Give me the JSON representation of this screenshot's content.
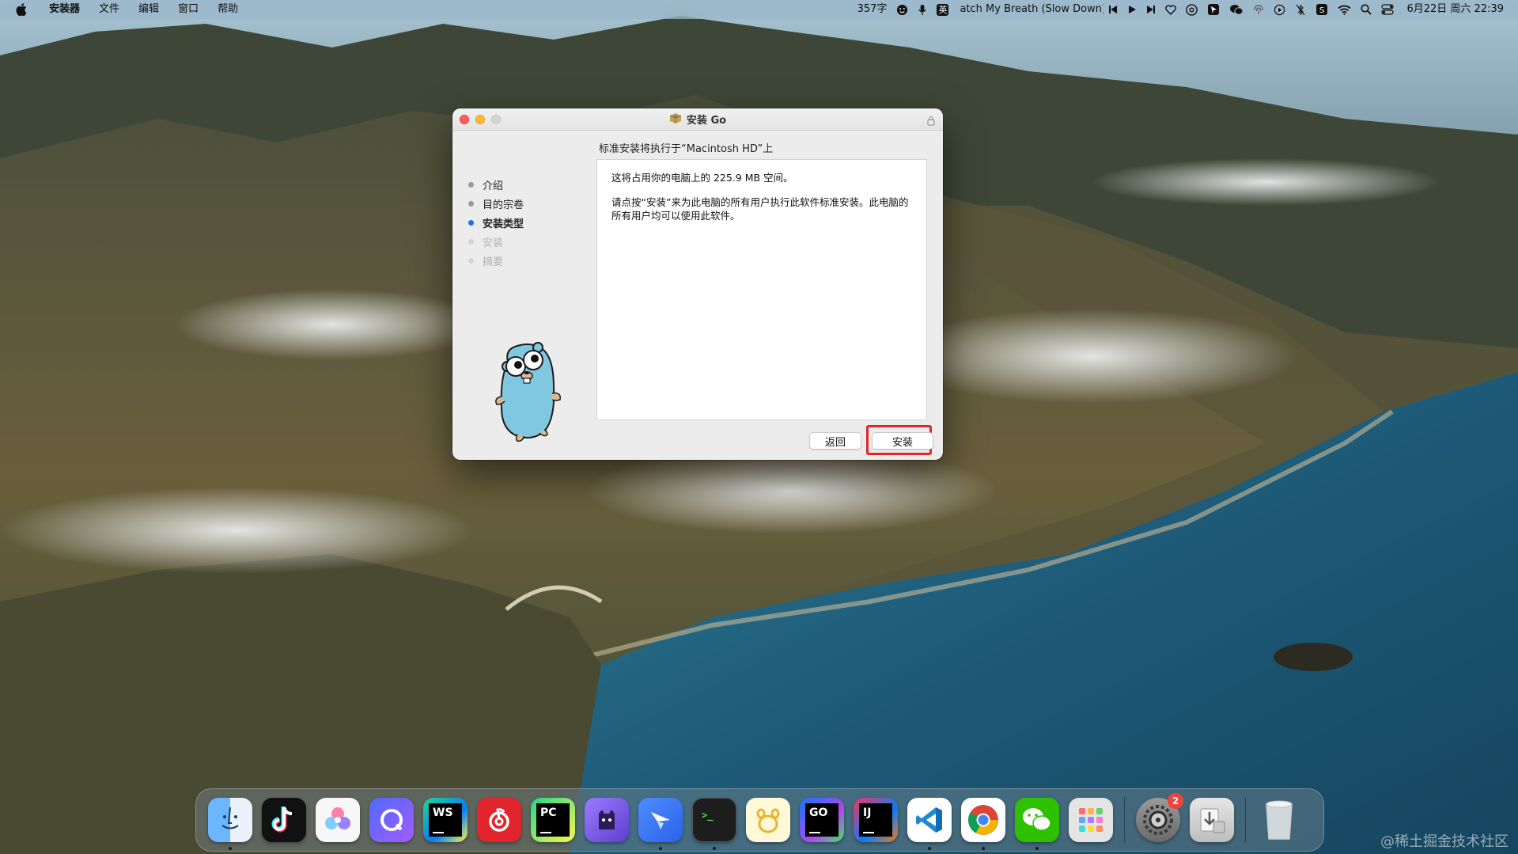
{
  "menubar": {
    "app_name": "安装器",
    "menus": [
      "文件",
      "编辑",
      "窗口",
      "帮助"
    ],
    "word_count": "357字",
    "input_method": "英",
    "now_playing": "atch My Breath (Slow Down)",
    "datetime": "6月22日 周六  22:39"
  },
  "window": {
    "title": "安装 Go",
    "subtitle": "标准安装将执行于“Macintosh HD”上",
    "steps": [
      {
        "label": "介绍",
        "state": "done"
      },
      {
        "label": "目的宗卷",
        "state": "done"
      },
      {
        "label": "安装类型",
        "state": "active"
      },
      {
        "label": "安装",
        "state": "pending"
      },
      {
        "label": "摘要",
        "state": "pending"
      }
    ],
    "body_line1": "这将占用你的电脑上的 225.9 MB 空间。",
    "body_line2": "请点按“安装”来为此电脑的所有用户执行此软件标准安装。此电脑的所有用户均可以使用此软件。",
    "back_button": "返回",
    "install_button": "安装"
  },
  "dock": {
    "items": [
      {
        "name": "finder-icon",
        "label": "",
        "bg": "#3d8af7"
      },
      {
        "name": "tiktok-icon",
        "label": "",
        "bg": "#111111"
      },
      {
        "name": "photos-app-icon",
        "label": "",
        "bg": "#f4f4f4"
      },
      {
        "name": "quark-browser-icon",
        "label": "",
        "bg": "#5b5ff0"
      },
      {
        "name": "webstorm-icon",
        "label": "WS",
        "bg": "#0c0c0c"
      },
      {
        "name": "netease-music-icon",
        "label": "",
        "bg": "#e2252c"
      },
      {
        "name": "pycharm-icon",
        "label": "PC",
        "bg": "#0c0c0c"
      },
      {
        "name": "github-desktop-icon",
        "label": "",
        "bg": "#7059e0"
      },
      {
        "name": "feishu-icon",
        "label": "",
        "bg": "#3d8af7"
      },
      {
        "name": "terminal-icon",
        "label": "",
        "bg": "#1d1d1d"
      },
      {
        "name": "paw-app-icon",
        "label": "",
        "bg": "#fff5c9"
      },
      {
        "name": "goland-icon",
        "label": "GO",
        "bg": "#0c0c0c"
      },
      {
        "name": "intellij-icon",
        "label": "IJ",
        "bg": "#0c0c0c"
      },
      {
        "name": "vscode-icon",
        "label": "",
        "bg": "#ffffff"
      },
      {
        "name": "chrome-icon",
        "label": "",
        "bg": "#ffffff"
      },
      {
        "name": "wechat-icon",
        "label": "",
        "bg": "#2dc100"
      },
      {
        "name": "launchpad-icon",
        "label": "",
        "bg": "#d9d9d9"
      }
    ],
    "settings_badge": "2"
  },
  "watermark": "@稀土掘金技术社区"
}
